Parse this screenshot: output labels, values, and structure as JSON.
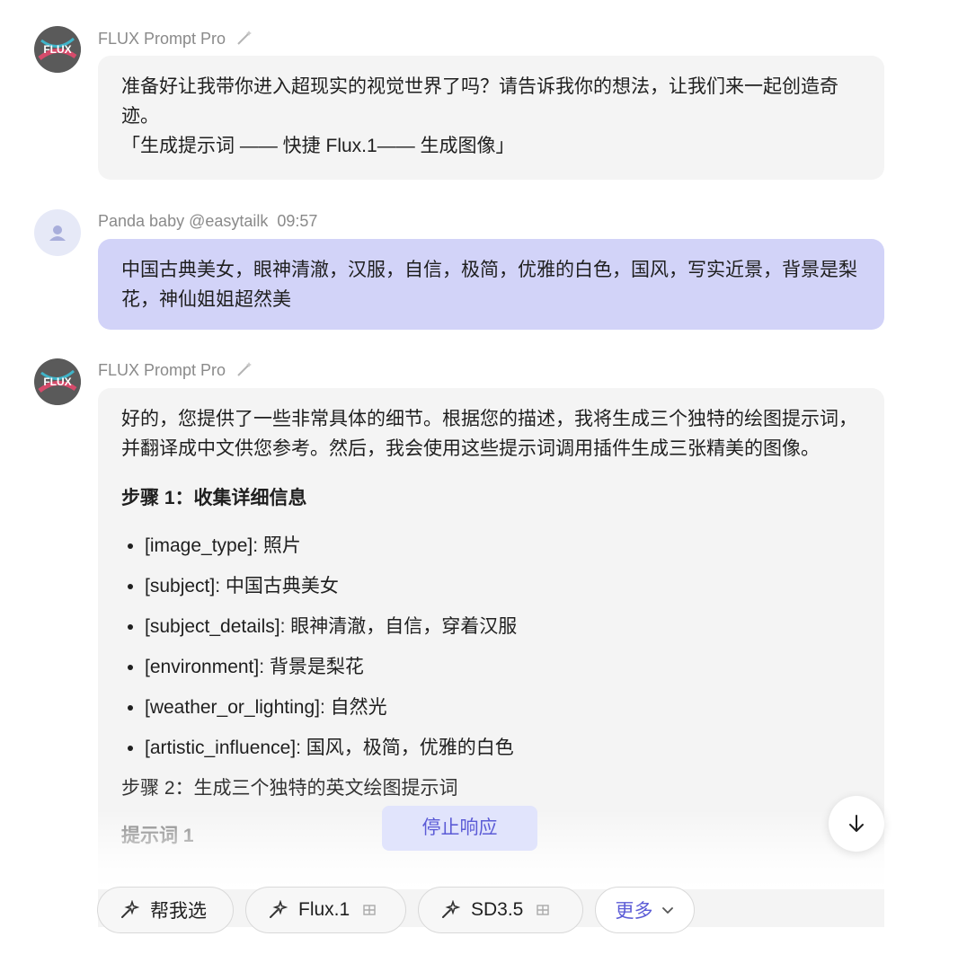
{
  "messages": [
    {
      "sender": "FLUX Prompt Pro",
      "text_line1": "准备好让我带你进入超现实的视觉世界了吗？请告诉我你的想法，让我们来一起创造奇迹。",
      "text_line2": "「生成提示词 —— 快捷 Flux.1—— 生成图像」"
    },
    {
      "sender": "Panda baby @easytailk",
      "time": "09:57",
      "text": "中国古典美女，眼神清澈，汉服，自信，极简，优雅的白色，国风，写实近景，背景是梨花，神仙姐姐超然美"
    },
    {
      "sender": "FLUX Prompt Pro",
      "intro": "好的，您提供了一些非常具体的细节。根据您的描述，我将生成三个独特的绘图提示词，并翻译成中文供您参考。然后，我会使用这些提示词调用插件生成三张精美的图像。",
      "step1": "步骤 1：收集详细信息",
      "details": [
        {
          "key": "[image_type]",
          "value": ": 照片"
        },
        {
          "key": "[subject]",
          "value": ": 中国古典美女"
        },
        {
          "key": "[subject_details]",
          "value": ": 眼神清澈，自信，穿着汉服"
        },
        {
          "key": "[environment]",
          "value": ": 背景是梨花"
        },
        {
          "key": "[weather_or_lighting]",
          "value": ": 自然光"
        },
        {
          "key": "[artistic_influence]",
          "value": ": 国风，极简，优雅的白色"
        }
      ],
      "step2": "步骤 2：生成三个独特的英文绘图提示词",
      "prompt1": "提示词 1"
    }
  ],
  "controls": {
    "stop_label": "停止响应",
    "chips": [
      {
        "label": "帮我选",
        "icon": "sparkle-icon"
      },
      {
        "label": "Flux.1",
        "icon": "sparkle-icon",
        "badge": "grid-icon"
      },
      {
        "label": "SD3.5",
        "icon": "sparkle-icon",
        "badge": "grid-icon"
      }
    ],
    "more_label": "更多"
  },
  "colors": {
    "user_bubble": "#d2d3f8",
    "bot_bubble": "#f4f4f4",
    "accent": "#5b5bd6"
  }
}
